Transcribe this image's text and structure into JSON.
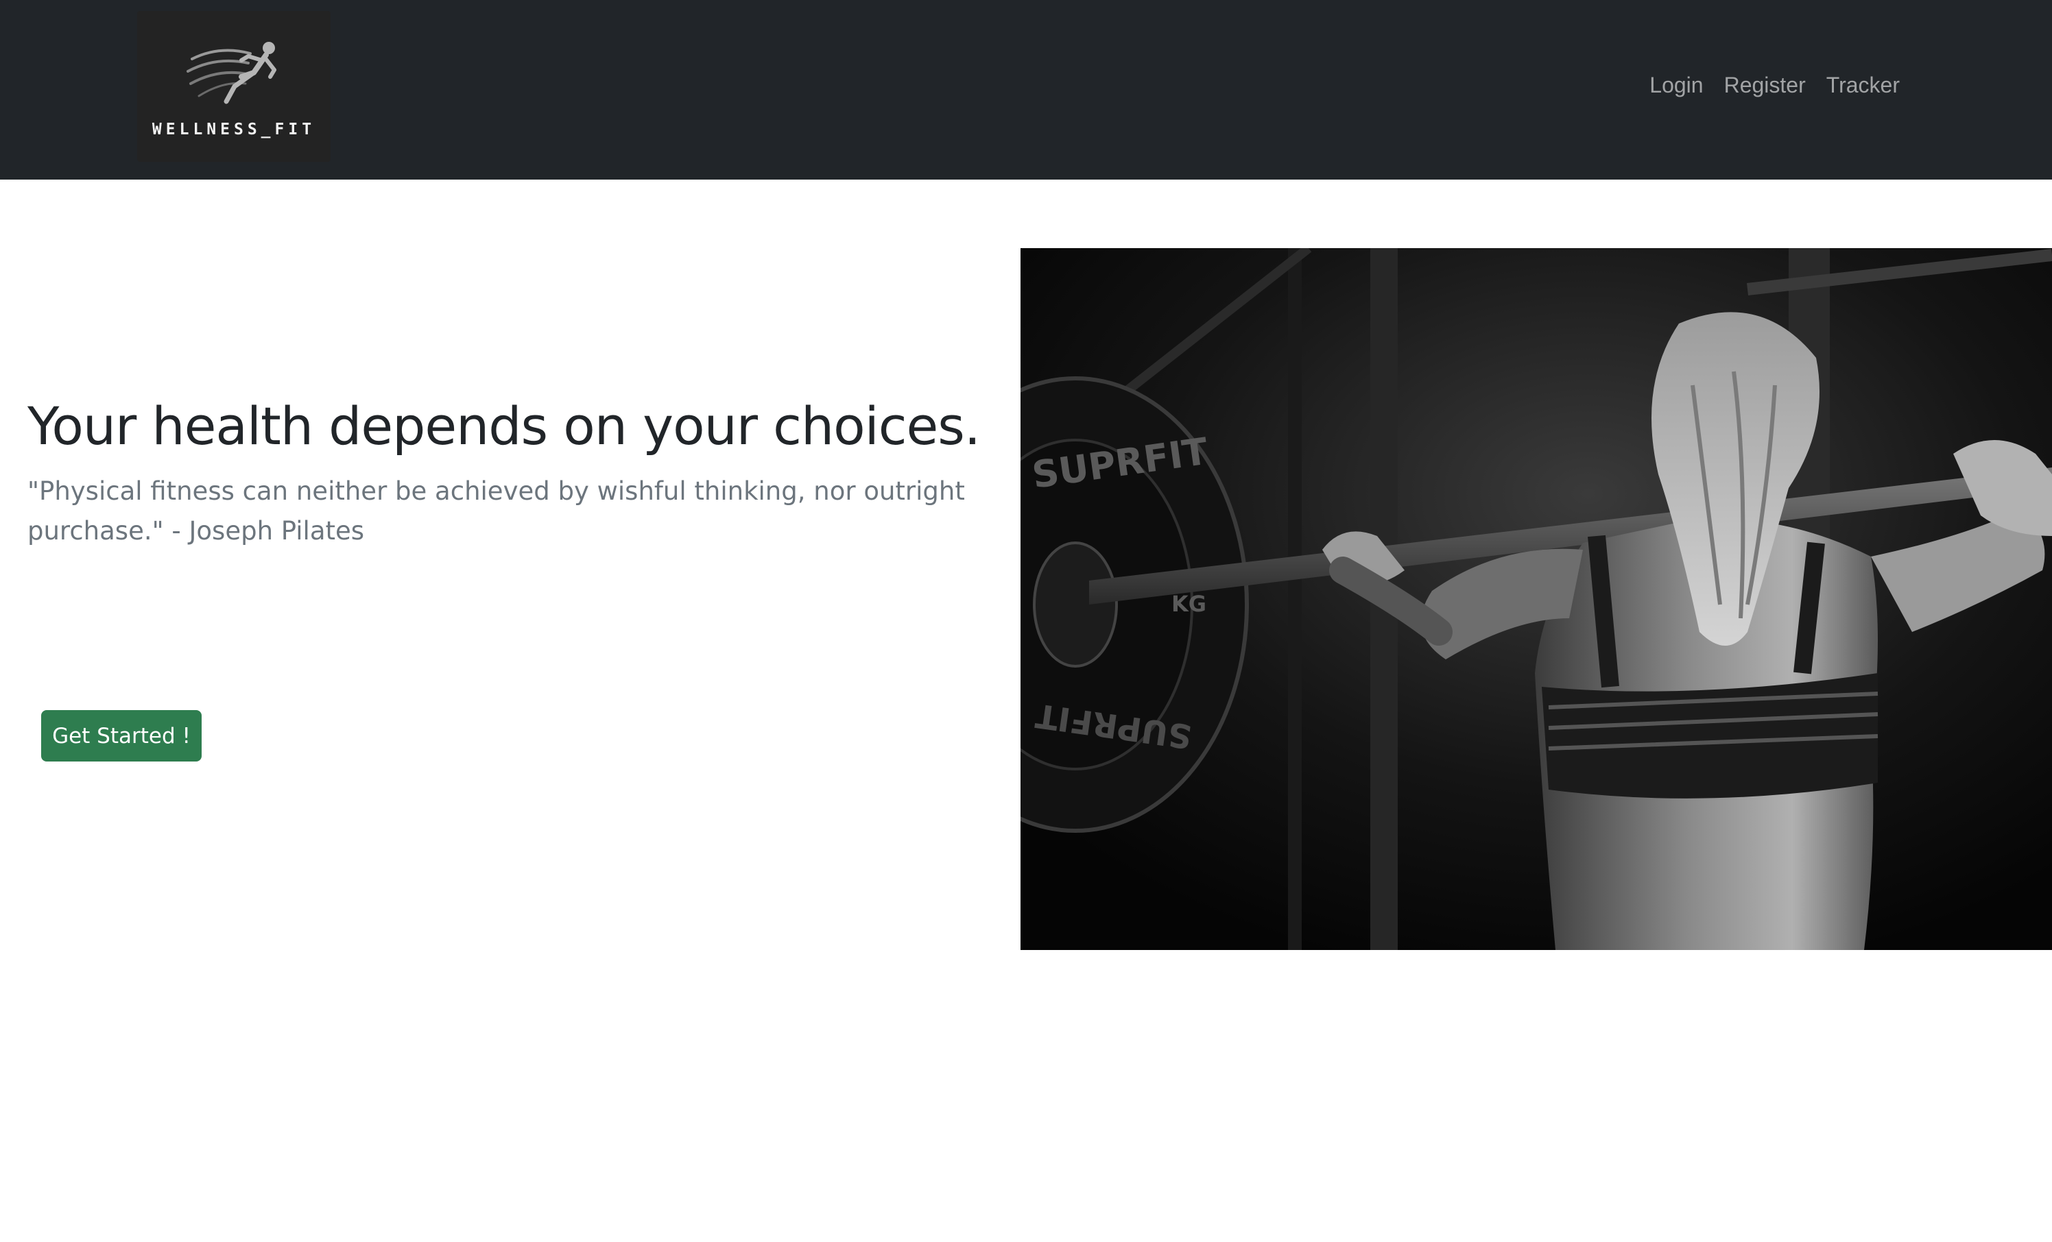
{
  "navbar": {
    "logo": {
      "text": "WELLNESS_FIT",
      "icon": "running-man-logo-icon"
    },
    "links": [
      {
        "label": "Login"
      },
      {
        "label": "Register"
      },
      {
        "label": "Tracker"
      }
    ]
  },
  "hero": {
    "title": "Your health depends on your choices.",
    "quote": "\"Physical fitness can neither be achieved by wishful thinking, nor outright purchase.\" - Joseph Pilates",
    "cta_label": "Get Started !",
    "image": {
      "plate_text": "SUPRFIT",
      "plate_text_2": "SUPRFIT",
      "plate_kg": "KG"
    }
  },
  "colors": {
    "navbar_bg": "#212529",
    "cta_bg": "#2e7d4f",
    "title": "#212529",
    "muted": "#6c757d"
  }
}
